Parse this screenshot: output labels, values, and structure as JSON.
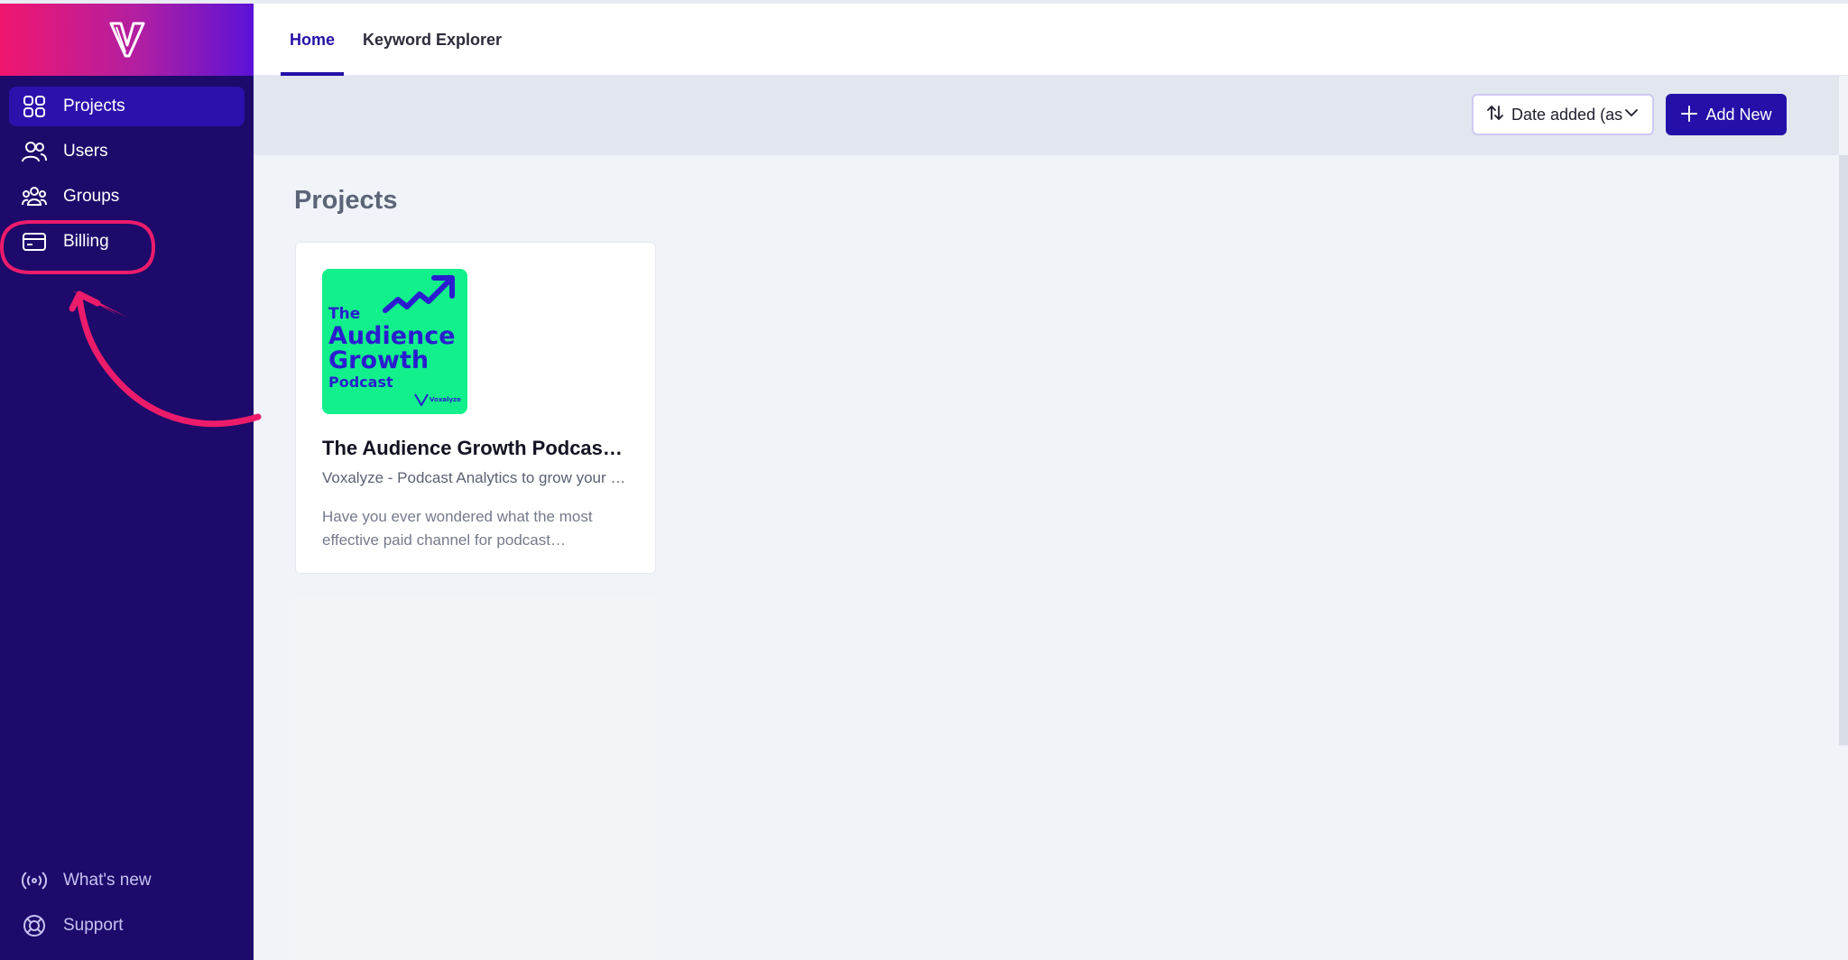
{
  "sidebar": {
    "items": [
      {
        "label": "Projects",
        "icon": "grid-icon",
        "active": true
      },
      {
        "label": "Users",
        "icon": "users-icon"
      },
      {
        "label": "Groups",
        "icon": "groups-icon"
      },
      {
        "label": "Billing",
        "icon": "credit-card-icon"
      }
    ],
    "bottom_items": [
      {
        "label": "What's new",
        "icon": "broadcast-icon"
      },
      {
        "label": "Support",
        "icon": "lifebuoy-icon"
      }
    ]
  },
  "tabs": [
    {
      "label": "Home",
      "active": true
    },
    {
      "label": "Keyword Explorer"
    }
  ],
  "toolbar": {
    "sort_label": "Date added (ascending)",
    "add_label": "Add New"
  },
  "main": {
    "section_title": "Projects",
    "projects": [
      {
        "title": "The Audience Growth Podcast: Marketing Strategies",
        "subtitle": "Voxalyze - Podcast Analytics to grow your show",
        "description": "Have you ever wondered what the most effective paid channel for podcast…",
        "cover": {
          "line1": "The",
          "line2": "Audience",
          "line3": "Growth",
          "line4": "Podcast",
          "brand": "Voxalyze"
        }
      }
    ]
  },
  "colors": {
    "sidebar_bg": "#1d0a6b",
    "accent": "#2410a8",
    "annotation": "#ec1c6b",
    "cover_bg": "#12f08b"
  }
}
